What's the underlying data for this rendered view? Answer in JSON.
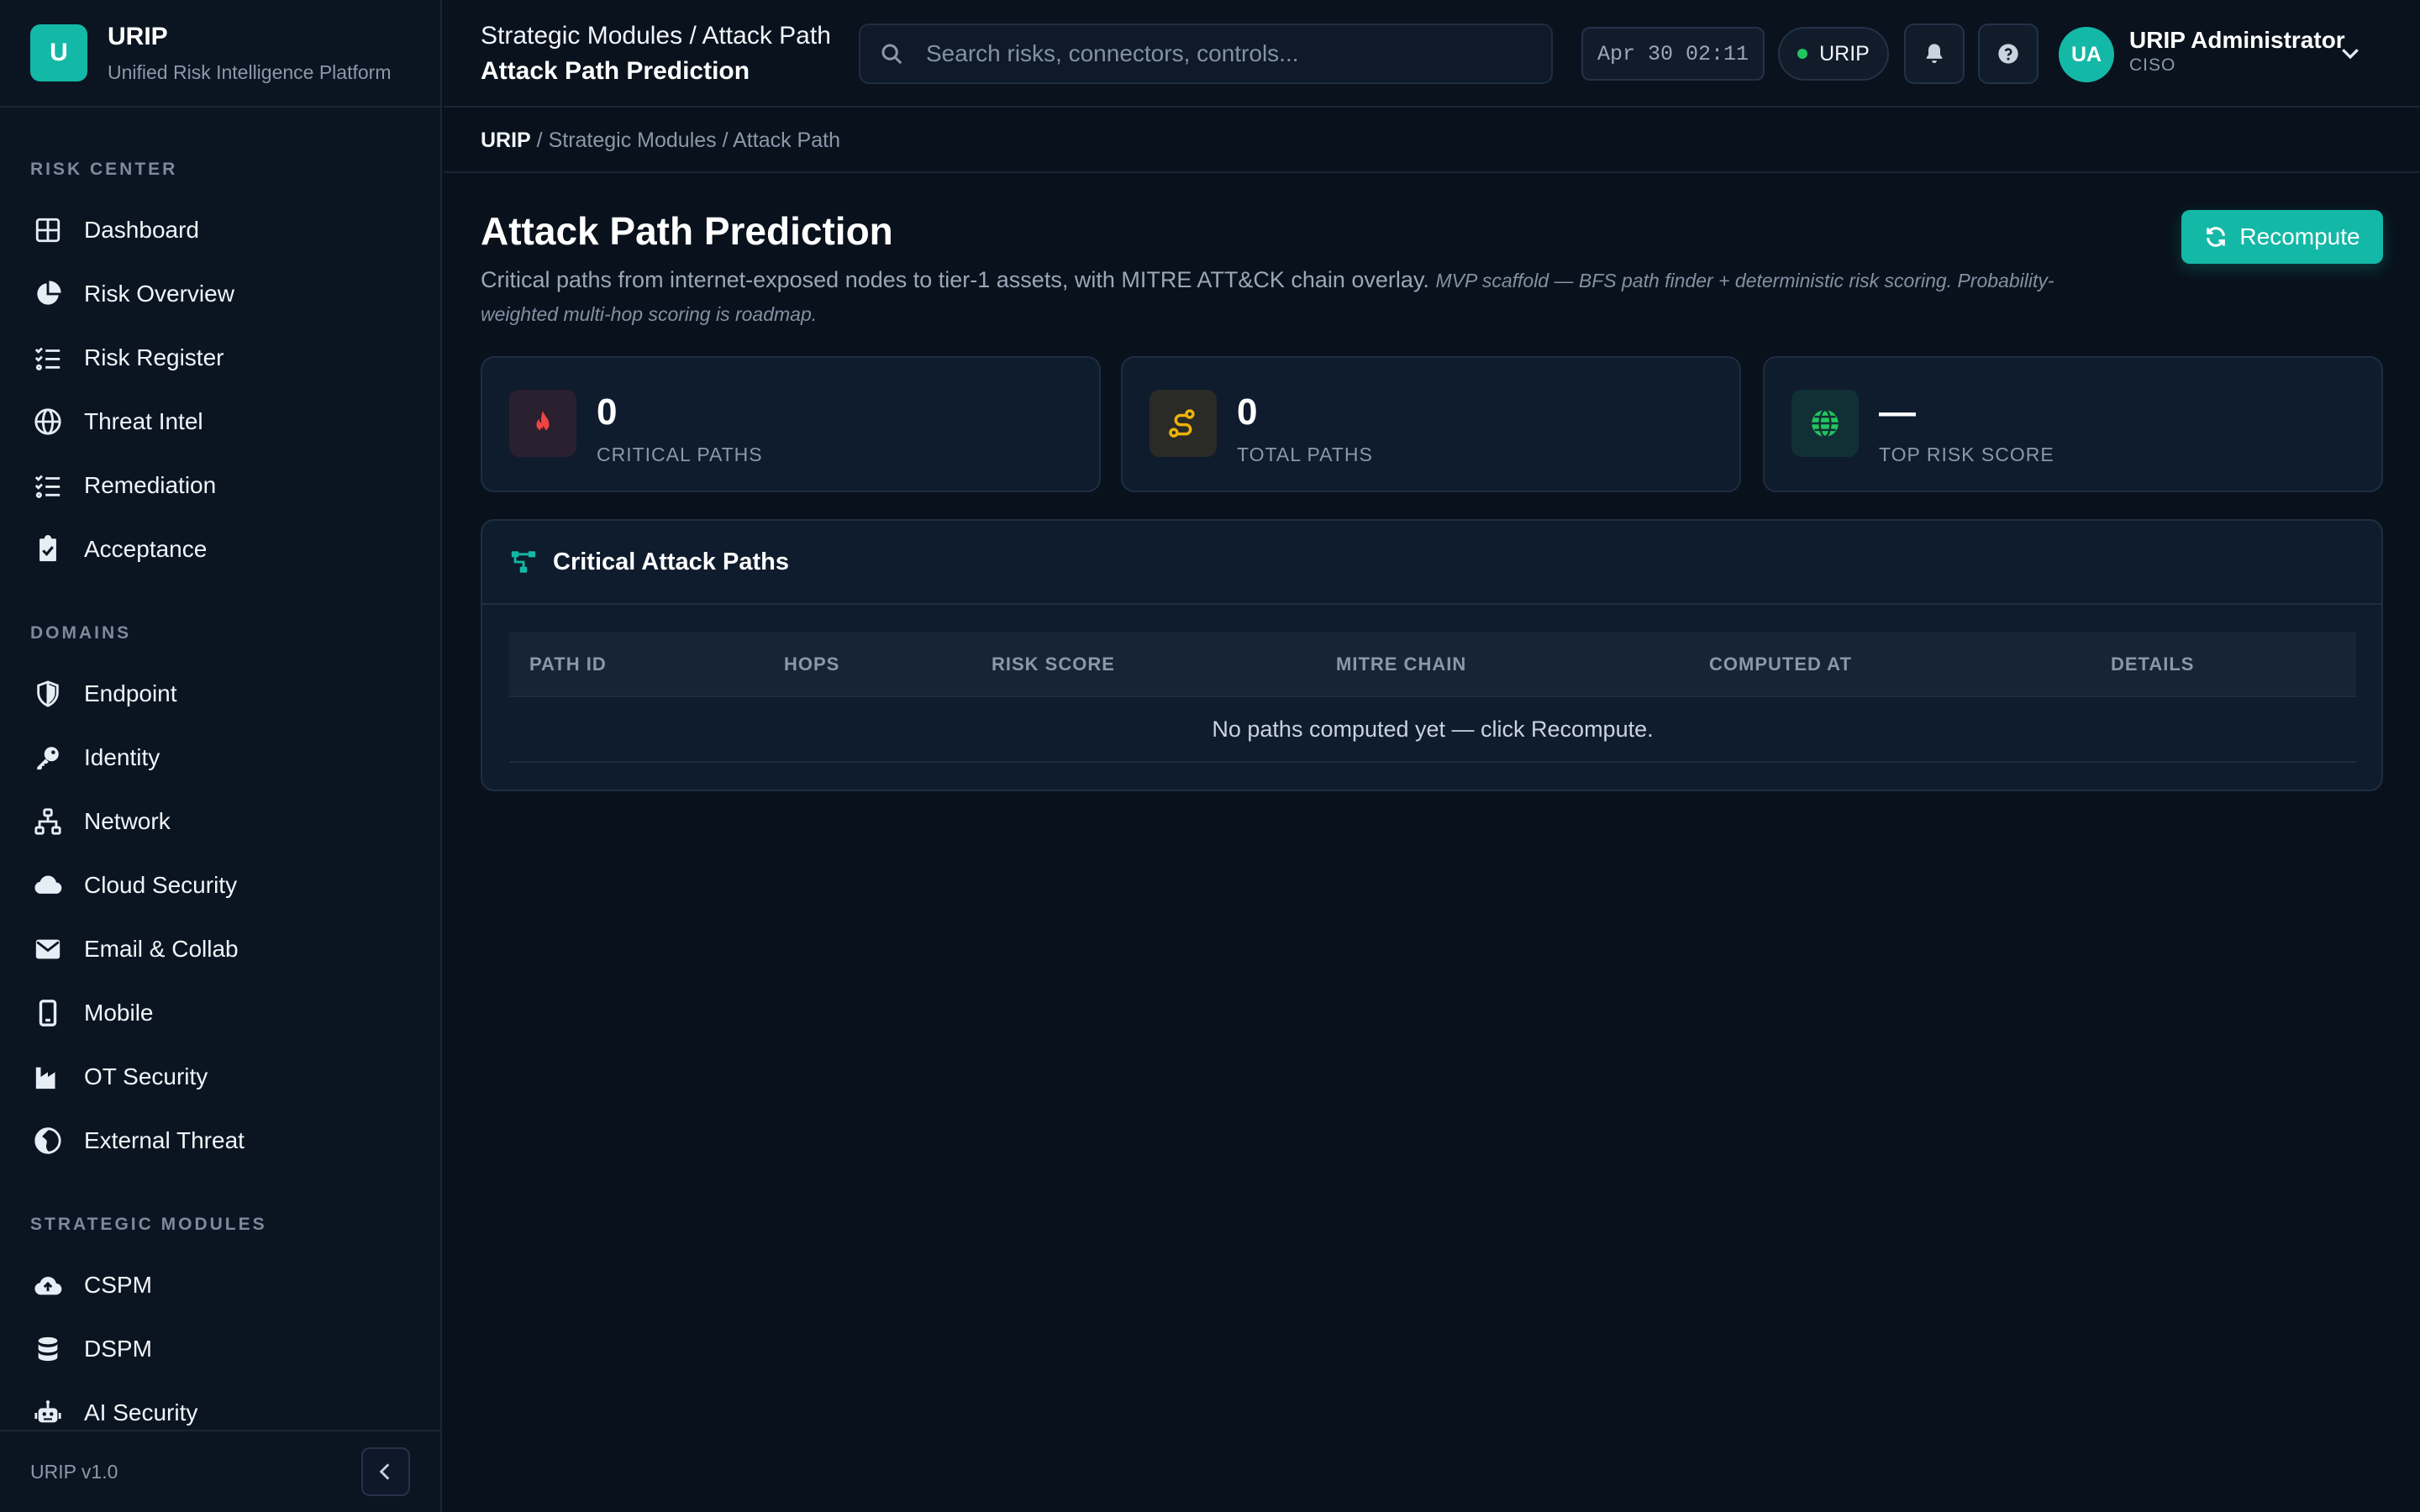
{
  "brand": {
    "logo_letter": "U",
    "name": "URIP",
    "subtitle": "Unified Risk Intelligence Platform"
  },
  "sidebar": {
    "sections": [
      {
        "heading": "RISK CENTER",
        "items": [
          {
            "label": "Dashboard",
            "icon": "grid-icon"
          },
          {
            "label": "Risk Overview",
            "icon": "pie-chart-icon"
          },
          {
            "label": "Risk Register",
            "icon": "list-check-icon"
          },
          {
            "label": "Threat Intel",
            "icon": "globe-icon"
          },
          {
            "label": "Remediation",
            "icon": "list-check-icon"
          },
          {
            "label": "Acceptance",
            "icon": "clipboard-check-icon"
          }
        ]
      },
      {
        "heading": "DOMAINS",
        "items": [
          {
            "label": "Endpoint",
            "icon": "shield-icon"
          },
          {
            "label": "Identity",
            "icon": "key-icon"
          },
          {
            "label": "Network",
            "icon": "network-icon"
          },
          {
            "label": "Cloud Security",
            "icon": "cloud-icon"
          },
          {
            "label": "Email & Collab",
            "icon": "envelope-icon"
          },
          {
            "label": "Mobile",
            "icon": "mobile-icon"
          },
          {
            "label": "OT Security",
            "icon": "industry-icon"
          },
          {
            "label": "External Threat",
            "icon": "globe-half-icon"
          }
        ]
      },
      {
        "heading": "STRATEGIC MODULES",
        "items": [
          {
            "label": "CSPM",
            "icon": "cloud-upload-icon"
          },
          {
            "label": "DSPM",
            "icon": "database-icon"
          },
          {
            "label": "AI Security",
            "icon": "robot-icon"
          }
        ]
      }
    ],
    "version": "URIP v1.0"
  },
  "topbar": {
    "crumb": "Strategic Modules / Attack Path",
    "title": "Attack Path Prediction",
    "search_placeholder": "Search risks, connectors, controls...",
    "clock": "Apr 30 02:11",
    "tenant": "URIP",
    "user_initials": "UA",
    "user_name": "URIP Administrator",
    "user_role": "CISO"
  },
  "breadcrumb": {
    "root": "URIP",
    "rest": " / Strategic Modules / Attack Path"
  },
  "page": {
    "title": "Attack Path Prediction",
    "description": "Critical paths from internet-exposed nodes to tier-1 assets, with MITRE ATT&CK chain overlay.",
    "note": "MVP scaffold — BFS path finder + deterministic risk scoring. Probability-weighted multi-hop scoring is roadmap.",
    "recompute_label": "Recompute"
  },
  "stats": [
    {
      "value": "0",
      "label": "CRITICAL PATHS",
      "icon": "fire-icon",
      "color": "#ef4444"
    },
    {
      "value": "0",
      "label": "TOTAL PATHS",
      "icon": "route-icon",
      "color": "#eab308"
    },
    {
      "value": "—",
      "label": "TOP RISK SCORE",
      "icon": "globe-icon",
      "color": "#22c55e"
    }
  ],
  "panel": {
    "title": "Critical Attack Paths",
    "columns": [
      "PATH ID",
      "HOPS",
      "RISK SCORE",
      "MITRE CHAIN",
      "COMPUTED AT",
      "DETAILS"
    ],
    "empty_message": "No paths computed yet — click Recompute."
  },
  "colors": {
    "accent": "#14b8a6",
    "background": "#09111c",
    "panel": "#0f1c2e"
  }
}
